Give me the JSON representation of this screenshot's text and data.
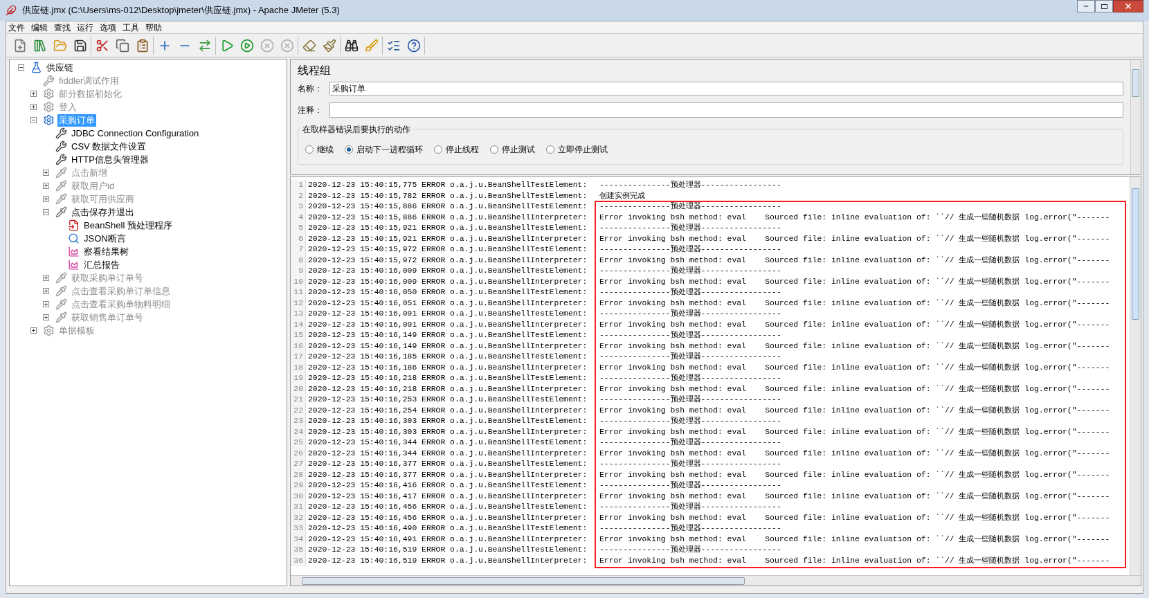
{
  "window": {
    "title": "供应链.jmx (C:\\Users\\ms-012\\Desktop\\jmeter\\供应链.jmx) - Apache JMeter (5.3)"
  },
  "menu": [
    "文件",
    "编辑",
    "查找",
    "运行",
    "选项",
    "工具",
    "帮助"
  ],
  "toolbar": [
    [
      {
        "kind": "new",
        "disabled": false
      },
      {
        "kind": "templates",
        "disabled": false
      },
      {
        "kind": "open",
        "disabled": false
      },
      {
        "kind": "save",
        "disabled": false
      }
    ],
    [
      {
        "kind": "cut",
        "disabled": false
      },
      {
        "kind": "copy",
        "disabled": false
      },
      {
        "kind": "paste",
        "disabled": false
      }
    ],
    [
      {
        "kind": "expand",
        "disabled": false
      },
      {
        "kind": "collapse",
        "disabled": false
      },
      {
        "kind": "toggle",
        "disabled": false
      }
    ],
    [
      {
        "kind": "start",
        "disabled": false
      },
      {
        "kind": "start-no-pause",
        "disabled": false
      },
      {
        "kind": "stop",
        "disabled": true
      },
      {
        "kind": "shutdown",
        "disabled": true
      }
    ],
    [
      {
        "kind": "clear",
        "disabled": false
      },
      {
        "kind": "clear-all",
        "disabled": false
      }
    ],
    [
      {
        "kind": "search",
        "disabled": false
      },
      {
        "kind": "reset-search",
        "disabled": false
      }
    ],
    [
      {
        "kind": "function-helper",
        "disabled": false
      },
      {
        "kind": "help",
        "disabled": false
      }
    ]
  ],
  "tree": [
    {
      "label": "供应链",
      "kind": "test-plan",
      "disabled": false,
      "selected": false,
      "expanded": true,
      "children": [
        {
          "label": "fiddler调试作用",
          "kind": "config",
          "disabled": true,
          "selected": false
        },
        {
          "label": "部分数据初始化",
          "kind": "thread-group",
          "disabled": true,
          "selected": false,
          "expanded": false
        },
        {
          "label": "登入",
          "kind": "thread-group",
          "disabled": true,
          "selected": false,
          "expanded": false
        },
        {
          "label": "采购订单",
          "kind": "thread-group-active",
          "disabled": false,
          "selected": true,
          "expanded": true,
          "children": [
            {
              "label": "JDBC Connection Configuration",
              "kind": "config",
              "disabled": false,
              "selected": false
            },
            {
              "label": "CSV 数据文件设置",
              "kind": "config",
              "disabled": false,
              "selected": false
            },
            {
              "label": "HTTP信息头管理器",
              "kind": "config",
              "disabled": false,
              "selected": false
            },
            {
              "label": "点击新增",
              "kind": "sampler",
              "disabled": true,
              "selected": false,
              "expanded": false
            },
            {
              "label": "获取用户id",
              "kind": "sampler",
              "disabled": true,
              "selected": false,
              "expanded": false
            },
            {
              "label": "获取可用供应商",
              "kind": "sampler",
              "disabled": true,
              "selected": false,
              "expanded": false
            },
            {
              "label": "点击保存并退出",
              "kind": "sampler",
              "disabled": false,
              "selected": false,
              "expanded": true,
              "children": [
                {
                  "label": "BeanShell 预处理程序",
                  "kind": "preprocessor",
                  "disabled": false,
                  "selected": false
                },
                {
                  "label": "JSON断言",
                  "kind": "assertion",
                  "disabled": false,
                  "selected": false
                },
                {
                  "label": "察看结果树",
                  "kind": "listener",
                  "disabled": false,
                  "selected": false
                },
                {
                  "label": "汇总报告",
                  "kind": "listener",
                  "disabled": false,
                  "selected": false
                }
              ]
            },
            {
              "label": "获取采购单订单号",
              "kind": "sampler",
              "disabled": true,
              "selected": false,
              "expanded": false
            },
            {
              "label": "点击查看采购单订单信息",
              "kind": "sampler",
              "disabled": true,
              "selected": false,
              "expanded": false
            },
            {
              "label": "点击查看采购单物料明细",
              "kind": "sampler",
              "disabled": true,
              "selected": false,
              "expanded": false
            },
            {
              "label": "获取销售单订单号",
              "kind": "sampler",
              "disabled": true,
              "selected": false,
              "expanded": false
            }
          ]
        },
        {
          "label": "单据模板",
          "kind": "thread-group",
          "disabled": true,
          "selected": false,
          "expanded": false
        }
      ]
    }
  ],
  "panel": {
    "title": "线程组",
    "name_label": "名称：",
    "name_value": "采购订单",
    "comment_label": "注释：",
    "error_action": {
      "legend": "在取样器错误后要执行的动作",
      "options": [
        {
          "label": "继续",
          "selected": false
        },
        {
          "label": "启动下一进程循环",
          "selected": true
        },
        {
          "label": "停止线程",
          "selected": false
        },
        {
          "label": "停止测试",
          "selected": false
        },
        {
          "label": "立即停止测试",
          "selected": false
        }
      ]
    }
  },
  "log": [
    {
      "n": "1",
      "prefix": "2020-12-23 15:40:15,775 ERROR o.a.j.u.BeanShellTestElement:",
      "message": "---------------预处理器-----------------"
    },
    {
      "n": "2",
      "prefix": "2020-12-23 15:40:15,782 ERROR o.a.j.u.BeanShellTestElement:",
      "message": "创建实例完成"
    },
    {
      "n": "3",
      "prefix": "2020-12-23 15:40:15,886 ERROR o.a.j.u.BeanShellTestElement:",
      "message": "---------------预处理器-----------------"
    },
    {
      "n": "4",
      "prefix": "2020-12-23 15:40:15,886 ERROR o.a.j.u.BeanShellInterpreter:",
      "message": "Error invoking bsh method: eval    Sourced file: inline evaluation of: ``// 生成一些随机数据 log.error(\"-------"
    },
    {
      "n": "5",
      "prefix": "2020-12-23 15:40:15,921 ERROR o.a.j.u.BeanShellTestElement:",
      "message": "---------------预处理器-----------------"
    },
    {
      "n": "6",
      "prefix": "2020-12-23 15:40:15,921 ERROR o.a.j.u.BeanShellInterpreter:",
      "message": "Error invoking bsh method: eval    Sourced file: inline evaluation of: ``// 生成一些随机数据 log.error(\"-------"
    },
    {
      "n": "7",
      "prefix": "2020-12-23 15:40:15,972 ERROR o.a.j.u.BeanShellTestElement:",
      "message": "---------------预处理器-----------------"
    },
    {
      "n": "8",
      "prefix": "2020-12-23 15:40:15,972 ERROR o.a.j.u.BeanShellInterpreter:",
      "message": "Error invoking bsh method: eval    Sourced file: inline evaluation of: ``// 生成一些随机数据 log.error(\"-------"
    },
    {
      "n": "9",
      "prefix": "2020-12-23 15:40:16,009 ERROR o.a.j.u.BeanShellTestElement:",
      "message": "---------------预处理器-----------------"
    },
    {
      "n": "10",
      "prefix": "2020-12-23 15:40:16,009 ERROR o.a.j.u.BeanShellInterpreter:",
      "message": "Error invoking bsh method: eval    Sourced file: inline evaluation of: ``// 生成一些随机数据 log.error(\"-------"
    },
    {
      "n": "11",
      "prefix": "2020-12-23 15:40:16,050 ERROR o.a.j.u.BeanShellTestElement:",
      "message": "---------------预处理器-----------------"
    },
    {
      "n": "12",
      "prefix": "2020-12-23 15:40:16,051 ERROR o.a.j.u.BeanShellInterpreter:",
      "message": "Error invoking bsh method: eval    Sourced file: inline evaluation of: ``// 生成一些随机数据 log.error(\"-------"
    },
    {
      "n": "13",
      "prefix": "2020-12-23 15:40:16,091 ERROR o.a.j.u.BeanShellTestElement:",
      "message": "---------------预处理器-----------------"
    },
    {
      "n": "14",
      "prefix": "2020-12-23 15:40:16,091 ERROR o.a.j.u.BeanShellInterpreter:",
      "message": "Error invoking bsh method: eval    Sourced file: inline evaluation of: ``// 生成一些随机数据 log.error(\"-------"
    },
    {
      "n": "15",
      "prefix": "2020-12-23 15:40:16,149 ERROR o.a.j.u.BeanShellTestElement:",
      "message": "---------------预处理器-----------------"
    },
    {
      "n": "16",
      "prefix": "2020-12-23 15:40:16,149 ERROR o.a.j.u.BeanShellInterpreter:",
      "message": "Error invoking bsh method: eval    Sourced file: inline evaluation of: ``// 生成一些随机数据 log.error(\"-------"
    },
    {
      "n": "17",
      "prefix": "2020-12-23 15:40:16,185 ERROR o.a.j.u.BeanShellTestElement:",
      "message": "---------------预处理器-----------------"
    },
    {
      "n": "18",
      "prefix": "2020-12-23 15:40:16,186 ERROR o.a.j.u.BeanShellInterpreter:",
      "message": "Error invoking bsh method: eval    Sourced file: inline evaluation of: ``// 生成一些随机数据 log.error(\"-------"
    },
    {
      "n": "19",
      "prefix": "2020-12-23 15:40:16,218 ERROR o.a.j.u.BeanShellTestElement:",
      "message": "---------------预处理器-----------------"
    },
    {
      "n": "20",
      "prefix": "2020-12-23 15:40:16,218 ERROR o.a.j.u.BeanShellInterpreter:",
      "message": "Error invoking bsh method: eval    Sourced file: inline evaluation of: ``// 生成一些随机数据 log.error(\"-------"
    },
    {
      "n": "21",
      "prefix": "2020-12-23 15:40:16,253 ERROR o.a.j.u.BeanShellTestElement:",
      "message": "---------------预处理器-----------------"
    },
    {
      "n": "22",
      "prefix": "2020-12-23 15:40:16,254 ERROR o.a.j.u.BeanShellInterpreter:",
      "message": "Error invoking bsh method: eval    Sourced file: inline evaluation of: ``// 生成一些随机数据 log.error(\"-------"
    },
    {
      "n": "23",
      "prefix": "2020-12-23 15:40:16,303 ERROR o.a.j.u.BeanShellTestElement:",
      "message": "---------------预处理器-----------------"
    },
    {
      "n": "24",
      "prefix": "2020-12-23 15:40:16,303 ERROR o.a.j.u.BeanShellInterpreter:",
      "message": "Error invoking bsh method: eval    Sourced file: inline evaluation of: ``// 生成一些随机数据 log.error(\"-------"
    },
    {
      "n": "25",
      "prefix": "2020-12-23 15:40:16,344 ERROR o.a.j.u.BeanShellTestElement:",
      "message": "---------------预处理器-----------------"
    },
    {
      "n": "26",
      "prefix": "2020-12-23 15:40:16,344 ERROR o.a.j.u.BeanShellInterpreter:",
      "message": "Error invoking bsh method: eval    Sourced file: inline evaluation of: ``// 生成一些随机数据 log.error(\"-------"
    },
    {
      "n": "27",
      "prefix": "2020-12-23 15:40:16,377 ERROR o.a.j.u.BeanShellTestElement:",
      "message": "---------------预处理器-----------------"
    },
    {
      "n": "28",
      "prefix": "2020-12-23 15:40:16,377 ERROR o.a.j.u.BeanShellInterpreter:",
      "message": "Error invoking bsh method: eval    Sourced file: inline evaluation of: ``// 生成一些随机数据 log.error(\"-------"
    },
    {
      "n": "29",
      "prefix": "2020-12-23 15:40:16,416 ERROR o.a.j.u.BeanShellTestElement:",
      "message": "---------------预处理器-----------------"
    },
    {
      "n": "30",
      "prefix": "2020-12-23 15:40:16,417 ERROR o.a.j.u.BeanShellInterpreter:",
      "message": "Error invoking bsh method: eval    Sourced file: inline evaluation of: ``// 生成一些随机数据 log.error(\"-------"
    },
    {
      "n": "31",
      "prefix": "2020-12-23 15:40:16,456 ERROR o.a.j.u.BeanShellTestElement:",
      "message": "---------------预处理器-----------------"
    },
    {
      "n": "32",
      "prefix": "2020-12-23 15:40:16,456 ERROR o.a.j.u.BeanShellInterpreter:",
      "message": "Error invoking bsh method: eval    Sourced file: inline evaluation of: ``// 生成一些随机数据 log.error(\"-------"
    },
    {
      "n": "33",
      "prefix": "2020-12-23 15:40:16,490 ERROR o.a.j.u.BeanShellTestElement:",
      "message": "---------------预处理器-----------------"
    },
    {
      "n": "34",
      "prefix": "2020-12-23 15:40:16,491 ERROR o.a.j.u.BeanShellInterpreter:",
      "message": "Error invoking bsh method: eval    Sourced file: inline evaluation of: ``// 生成一些随机数据 log.error(\"-------"
    },
    {
      "n": "35",
      "prefix": "2020-12-23 15:40:16,519 ERROR o.a.j.u.BeanShellTestElement:",
      "message": "---------------预处理器-----------------"
    },
    {
      "n": "36",
      "prefix": "2020-12-23 15:40:16,519 ERROR o.a.j.u.BeanShellInterpreter:",
      "message": "Error invoking bsh method: eval    Sourced file: inline evaluation of: ``// 生成一些随机数据 log.error(\"-------"
    }
  ]
}
